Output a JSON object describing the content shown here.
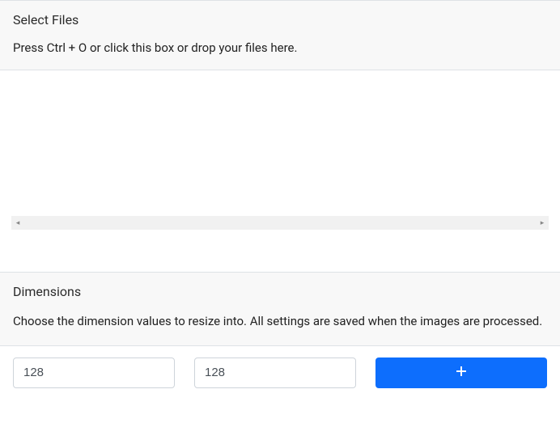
{
  "select_files": {
    "title": "Select Files",
    "description": "Press Ctrl + O or click this box or drop your files here."
  },
  "dimensions": {
    "title": "Dimensions",
    "description": "Choose the dimension values to resize into. All settings are saved when the images are processed.",
    "width_value": "128",
    "height_value": "128"
  }
}
